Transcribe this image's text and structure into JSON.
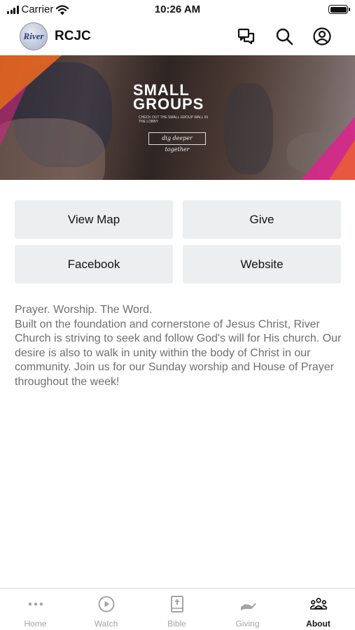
{
  "status_bar": {
    "carrier": "Carrier",
    "time": "10:26 AM"
  },
  "header": {
    "logo_text": "River",
    "title": "RCJC"
  },
  "banner": {
    "title_line1": "SMALL",
    "title_line2": "GROUPS",
    "subtitle": "CHECK OUT THE SMALL GROUP WALL IN THE LOBBY",
    "tagline": "dig deeper together"
  },
  "buttons": {
    "view_map": "View Map",
    "give": "Give",
    "facebook": "Facebook",
    "website": "Website"
  },
  "description": "Prayer. Worship. The Word.\nBuilt on the foundation and cornerstone of Jesus Christ, River Church is striving to seek and follow God's will for His church. Our desire is also to walk in unity within the body of Christ in our community. Join us for our Sunday worship and House of Prayer throughout the week!",
  "tabs": [
    {
      "label": "Home",
      "icon": "more-dots-icon"
    },
    {
      "label": "Watch",
      "icon": "play-circle-icon"
    },
    {
      "label": "Bible",
      "icon": "bible-icon"
    },
    {
      "label": "Giving",
      "icon": "giving-hand-icon"
    },
    {
      "label": "About",
      "icon": "people-icon",
      "active": true
    }
  ],
  "colors": {
    "accent_orange": "#f26a21",
    "accent_pink": "#d8278b",
    "button_bg": "#eceeef",
    "tab_inactive": "#a4a4a4"
  }
}
